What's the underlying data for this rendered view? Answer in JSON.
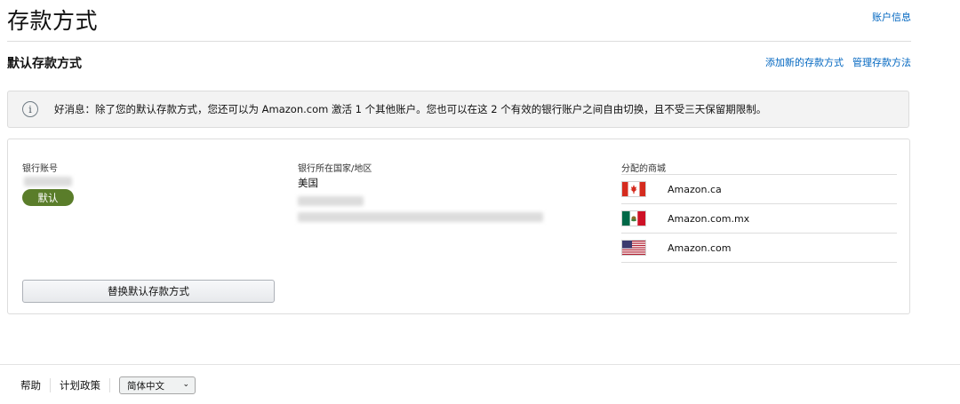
{
  "page": {
    "title": "存款方式",
    "account_info_link": "账户信息"
  },
  "section": {
    "title": "默认存款方式",
    "add_link": "添加新的存款方式",
    "manage_link": "管理存款方法"
  },
  "info_banner": {
    "icon": "info-icon",
    "text": "好消息：除了您的默认存款方式，您还可以为 Amazon.com 激活 1 个其他账户。您也可以在这 2 个有效的银行账户之间自由切换，且不受三天保留期限制。"
  },
  "card": {
    "bank_account_label": "银行账号",
    "default_badge": "默认",
    "bank_country_label": "银行所在国家/地区",
    "bank_country_value": "美国",
    "marketplaces_label": "分配的商城",
    "marketplaces": [
      {
        "name": "Amazon.ca",
        "flag": "canada-flag-icon"
      },
      {
        "name": "Amazon.com.mx",
        "flag": "mexico-flag-icon"
      },
      {
        "name": "Amazon.com",
        "flag": "usa-flag-icon"
      }
    ],
    "replace_button": "替换默认存款方式"
  },
  "footer": {
    "help": "帮助",
    "policy": "计划政策",
    "language_selected": "简体中文"
  },
  "colors": {
    "link": "#0066c0",
    "badge": "#5a7d2a",
    "banner_bg": "#f3f3f3"
  }
}
